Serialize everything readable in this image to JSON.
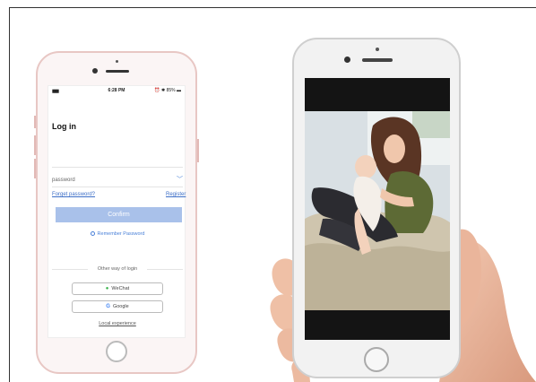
{
  "login_screen": {
    "status_bar": {
      "signal": "▮▮▮▮",
      "time": "6:28 PM",
      "right": "⏰ ✱ 85% ▬"
    },
    "title": "Log in",
    "password_placeholder": "password",
    "forget_password": "Forget password?",
    "register": "Register",
    "confirm": "Confirm",
    "remember_password": "Remember Password",
    "other_way": "Other way of login",
    "wechat": "WeChat",
    "google": "Google",
    "local_experience": "Local experience"
  },
  "icons": {
    "wechat": "wechat-icon",
    "google": "google-icon",
    "chevron": "chevron-down-icon",
    "radio": "radio-icon"
  },
  "colors": {
    "accent_blue": "#4a80d8",
    "confirm_bg": "#a9c1ea",
    "phone_left_frame": "#e8c7c4",
    "wechat_green": "#37b34a"
  }
}
